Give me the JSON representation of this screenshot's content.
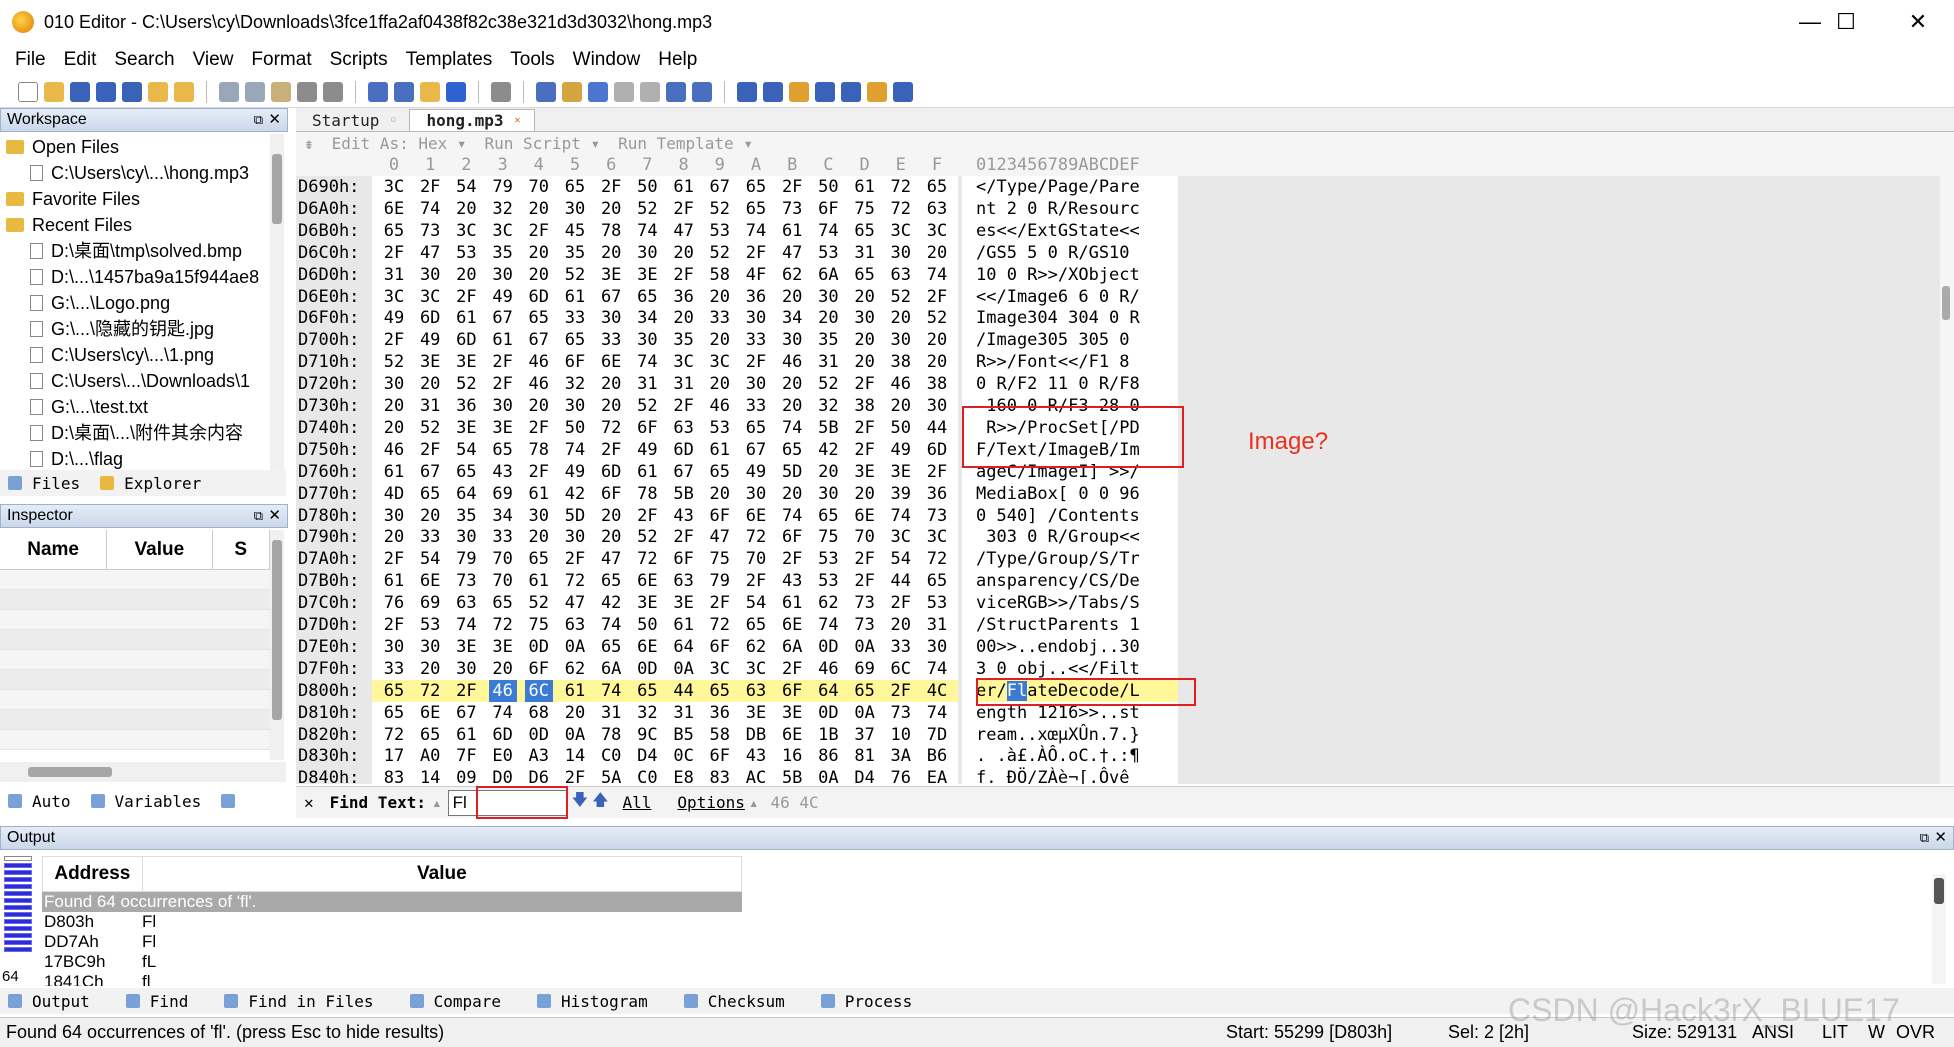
{
  "window": {
    "title": "010 Editor - C:\\Users\\cy\\Downloads\\3fce1ffa2af0438f82c38e321d3d3032\\hong.mp3",
    "minimize": "—",
    "maximize": "☐",
    "close": "✕"
  },
  "menu": [
    "File",
    "Edit",
    "Search",
    "View",
    "Format",
    "Scripts",
    "Templates",
    "Tools",
    "Window",
    "Help"
  ],
  "workspace": {
    "title": "Workspace",
    "items": [
      {
        "kind": "folder",
        "label": "Open Files"
      },
      {
        "kind": "file",
        "label": "C:\\Users\\cy\\...\\hong.mp3"
      },
      {
        "kind": "folder",
        "label": "Favorite Files"
      },
      {
        "kind": "folder",
        "label": "Recent Files"
      },
      {
        "kind": "file",
        "label": "D:\\桌面\\tmp\\solved.bmp"
      },
      {
        "kind": "file",
        "label": "D:\\...\\1457ba9a15f944ae8"
      },
      {
        "kind": "file",
        "label": "G:\\...\\Logo.png"
      },
      {
        "kind": "file",
        "label": "G:\\...\\隐藏的钥匙.jpg"
      },
      {
        "kind": "file",
        "label": "C:\\Users\\cy\\...\\1.png"
      },
      {
        "kind": "file",
        "label": "C:\\Users\\...\\Downloads\\1"
      },
      {
        "kind": "file",
        "label": "G:\\...\\test.txt"
      },
      {
        "kind": "file",
        "label": "D:\\桌面\\...\\附件其余内容"
      },
      {
        "kind": "file",
        "label": "D:\\...\\flag"
      }
    ],
    "tabs": [
      "Files",
      "Explorer"
    ]
  },
  "inspector": {
    "title": "Inspector",
    "columns": [
      "Name",
      "Value",
      "S"
    ],
    "tabs": [
      "Auto",
      "Variables"
    ]
  },
  "editor": {
    "tabs": [
      "Startup",
      "hong.mp3"
    ],
    "sub_toolbar": [
      "Edit As: Hex ▾",
      "Run Script ▾",
      "Run Template ▾"
    ],
    "column_header": [
      "0",
      "1",
      "2",
      "3",
      "4",
      "5",
      "6",
      "7",
      "8",
      "9",
      "A",
      "B",
      "C",
      "D",
      "E",
      "F"
    ],
    "ascii_header": "0123456789ABCDEF",
    "rows": [
      {
        "addr": "D690h:",
        "hex": "3C 2F 54 79 70 65 2F 50 61 67 65 2F 50 61 72 65",
        "ascii": "</Type/Page/Pare"
      },
      {
        "addr": "D6A0h:",
        "hex": "6E 74 20 32 20 30 20 52 2F 52 65 73 6F 75 72 63",
        "ascii": "nt 2 0 R/Resourc"
      },
      {
        "addr": "D6B0h:",
        "hex": "65 73 3C 3C 2F 45 78 74 47 53 74 61 74 65 3C 3C",
        "ascii": "es<</ExtGState<<"
      },
      {
        "addr": "D6C0h:",
        "hex": "2F 47 53 35 20 35 20 30 20 52 2F 47 53 31 30 20",
        "ascii": "/GS5 5 0 R/GS10 "
      },
      {
        "addr": "D6D0h:",
        "hex": "31 30 20 30 20 52 3E 3E 2F 58 4F 62 6A 65 63 74",
        "ascii": "10 0 R>>/XObject"
      },
      {
        "addr": "D6E0h:",
        "hex": "3C 3C 2F 49 6D 61 67 65 36 20 36 20 30 20 52 2F",
        "ascii": "<</Image6 6 0 R/"
      },
      {
        "addr": "D6F0h:",
        "hex": "49 6D 61 67 65 33 30 34 20 33 30 34 20 30 20 52",
        "ascii": "Image304 304 0 R"
      },
      {
        "addr": "D700h:",
        "hex": "2F 49 6D 61 67 65 33 30 35 20 33 30 35 20 30 20",
        "ascii": "/Image305 305 0 "
      },
      {
        "addr": "D710h:",
        "hex": "52 3E 3E 2F 46 6F 6E 74 3C 3C 2F 46 31 20 38 20",
        "ascii": "R>>/Font<</F1 8 "
      },
      {
        "addr": "D720h:",
        "hex": "30 20 52 2F 46 32 20 31 31 20 30 20 52 2F 46 38",
        "ascii": "0 R/F2 11 0 R/F8"
      },
      {
        "addr": "D730h:",
        "hex": "20 31 36 30 20 30 20 52 2F 46 33 20 32 38 20 30",
        "ascii": " 160 0 R/F3 28 0"
      },
      {
        "addr": "D740h:",
        "hex": "20 52 3E 3E 2F 50 72 6F 63 53 65 74 5B 2F 50 44",
        "ascii": " R>>/ProcSet[/PD"
      },
      {
        "addr": "D750h:",
        "hex": "46 2F 54 65 78 74 2F 49 6D 61 67 65 42 2F 49 6D",
        "ascii": "F/Text/ImageB/Im"
      },
      {
        "addr": "D760h:",
        "hex": "61 67 65 43 2F 49 6D 61 67 65 49 5D 20 3E 3E 2F",
        "ascii": "ageC/ImageI] >>/"
      },
      {
        "addr": "D770h:",
        "hex": "4D 65 64 69 61 42 6F 78 5B 20 30 20 30 20 39 36",
        "ascii": "MediaBox[ 0 0 96"
      },
      {
        "addr": "D780h:",
        "hex": "30 20 35 34 30 5D 20 2F 43 6F 6E 74 65 6E 74 73",
        "ascii": "0 540] /Contents"
      },
      {
        "addr": "D790h:",
        "hex": "20 33 30 33 20 30 20 52 2F 47 72 6F 75 70 3C 3C",
        "ascii": " 303 0 R/Group<<"
      },
      {
        "addr": "D7A0h:",
        "hex": "2F 54 79 70 65 2F 47 72 6F 75 70 2F 53 2F 54 72",
        "ascii": "/Type/Group/S/Tr"
      },
      {
        "addr": "D7B0h:",
        "hex": "61 6E 73 70 61 72 65 6E 63 79 2F 43 53 2F 44 65",
        "ascii": "ansparency/CS/De"
      },
      {
        "addr": "D7C0h:",
        "hex": "76 69 63 65 52 47 42 3E 3E 2F 54 61 62 73 2F 53",
        "ascii": "viceRGB>>/Tabs/S"
      },
      {
        "addr": "D7D0h:",
        "hex": "2F 53 74 72 75 63 74 50 61 72 65 6E 74 73 20 31",
        "ascii": "/StructParents 1"
      },
      {
        "addr": "D7E0h:",
        "hex": "30 30 3E 3E 0D 0A 65 6E 64 6F 62 6A 0D 0A 33 30",
        "ascii": "00>>..endobj..30"
      },
      {
        "addr": "D7F0h:",
        "hex": "33 20 30 20 6F 62 6A 0D 0A 3C 3C 2F 46 69 6C 74",
        "ascii": "3 0 obj..<</Filt"
      },
      {
        "addr": "D800h:",
        "hex": "65 72 2F 46 6C 61 74 65 44 65 63 6F 64 65 2F 4C",
        "ascii": "er/FlateDecode/L"
      },
      {
        "addr": "D810h:",
        "hex": "65 6E 67 74 68 20 31 32 31 36 3E 3E 0D 0A 73 74",
        "ascii": "ength 1216>>..st"
      },
      {
        "addr": "D820h:",
        "hex": "72 65 61 6D 0D 0A 78 9C B5 58 DB 6E 1B 37 10 7D",
        "ascii": "ream..xœµXÛn.7.}"
      },
      {
        "addr": "D830h:",
        "hex": "17 A0 7F E0 A3 14 C0 D4 0C 6F 43 16 86 81 3A B6",
        "ascii": ". .à£.ÀÔ.oC.†.:¶"
      },
      {
        "addr": "D840h:",
        "hex": "83 14 09 D0 D6 2F 5A C0 E8 83 AC 5B 0A D4 76 EA",
        "ascii": "f. ÐÖ/ZÀè¬[.Ôvê"
      }
    ],
    "annotation": "Image?"
  },
  "findbar": {
    "label": "Find Text:",
    "value": "Fl",
    "all": "All",
    "options": "Options",
    "hex_hint": "46 4C"
  },
  "output": {
    "title": "Output",
    "columns": [
      "Address",
      "Value"
    ],
    "summary": "Found 64 occurrences of 'fl'.",
    "rows": [
      {
        "address": "D803h",
        "value": "Fl"
      },
      {
        "address": "DD7Ah",
        "value": "Fl"
      },
      {
        "address": "17BC9h",
        "value": "fL"
      },
      {
        "address": "1841Ch",
        "value": "fl"
      }
    ],
    "count": "64",
    "tabs": [
      "Output",
      "Find",
      "Find in Files",
      "Compare",
      "Histogram",
      "Checksum",
      "Process"
    ]
  },
  "status": {
    "message": "Found 64 occurrences of 'fl'. (press Esc to hide results)",
    "start": "Start: 55299 [D803h]",
    "sel": "Sel: 2 [2h]",
    "size": "Size: 529131",
    "encoding": "ANSI",
    "endian": "LIT",
    "w": "W",
    "mode": "OVR"
  },
  "watermark": "CSDN @Hack3rX_BLUE17",
  "colors": {
    "selection": "#3b7bd6",
    "highlight_row": "#fff79a",
    "annotation": "#e02020"
  }
}
